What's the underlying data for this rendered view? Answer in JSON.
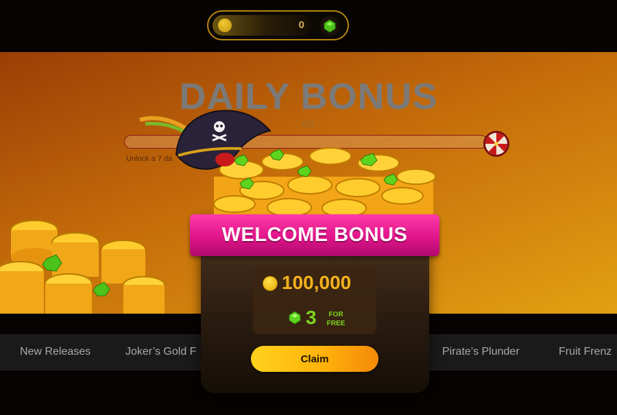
{
  "wallet": {
    "coin_icon": "coin-icon",
    "coin_balance": "0",
    "gem_icon": "gem-icon"
  },
  "daily_bonus": {
    "title": "DAILY BONUS",
    "progress_text": "0/7",
    "progress_fraction": 0,
    "unlock_text": "Unlock a 7 da",
    "reward_icon": "prize-wheel-icon"
  },
  "nav": {
    "items": [
      "New Releases",
      "Joker’s Gold F",
      "Pirate’s Plunder",
      "Fruit Frenz"
    ]
  },
  "modal": {
    "title": "WELCOME BONUS",
    "coins_amount": "100,000",
    "gems_amount": "3",
    "gems_caption_line1": "FOR",
    "gems_caption_line2": "FREE",
    "claim_label": "Claim"
  },
  "colors": {
    "accent_pink": "#e0158a",
    "gold": "#f3b21d",
    "gem_green": "#7ed321",
    "button_gold": "#ffb30a"
  }
}
